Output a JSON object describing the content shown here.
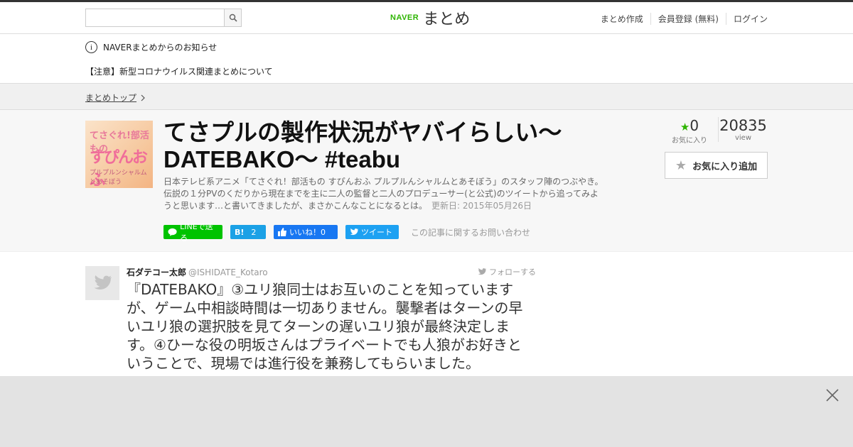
{
  "header": {
    "search_placeholder": "",
    "logo_naver": "NAVER",
    "logo_matome": "まとめ",
    "nav": [
      "まとめ作成",
      "会員登録 (無料)",
      "ログイン"
    ]
  },
  "notice": {
    "title": "NAVERまとめからのお知らせ",
    "item": "【注意】新型コロナウイルス関連まとめについて"
  },
  "breadcrumb": {
    "top": "まとめトップ"
  },
  "article": {
    "thumb_lines": [
      "てさぐれ!部活もの",
      "すぴんおふ",
      "プルプルンシャルムとあそぼう"
    ],
    "title": "てさプルの製作状況がヤバイらしい～DATEBAKO～ #teabu",
    "description": "日本テレビ系アニメ「てさぐれ！部活もの すぴんおふ プルプルんシャルムとあそぼう」のスタッフ陣のつぶやき。伝説の１分PVのくだりから現在までを主に二人の監督と二人のプロデューサー(と公式)のツイートから追ってみようと思います…と書いてきましたが、まさかこんなことになるとは。",
    "updated": "更新日: 2015年05月26日",
    "favorites_count": "0",
    "favorites_label": "お気に入り",
    "views_count": "20835",
    "views_label": "view",
    "fav_button": "お気に入り追加",
    "share": {
      "line": "LINEで送る",
      "hatena": "B!",
      "hatena_count": "2",
      "facebook": "いいね！0",
      "twitter": "ツイート",
      "inquiry": "この記事に関するお問い合わせ"
    }
  },
  "tweet": {
    "name": "石ダテコー太郎",
    "handle": "@ISHIDATE_Kotaro",
    "follow": "フォローする",
    "text": "『DATEBAKO』③ユリ狼同士はお互いのことを知っていますが、ゲーム中相談時間は一切ありません。襲撃者はターンの早いユリ狼の選択肢を見てターンの遅いユリ狼が最終決定します。④ひーな役の明坂さんはプライベートでも人狼がお好きということで、現場では進行役を兼務してもらいました。"
  },
  "colors": {
    "accent": "#2db400",
    "overlay": "#e3e3e3"
  },
  "icons": {
    "search": "search-icon",
    "info": "info-icon",
    "close": "close-icon"
  }
}
